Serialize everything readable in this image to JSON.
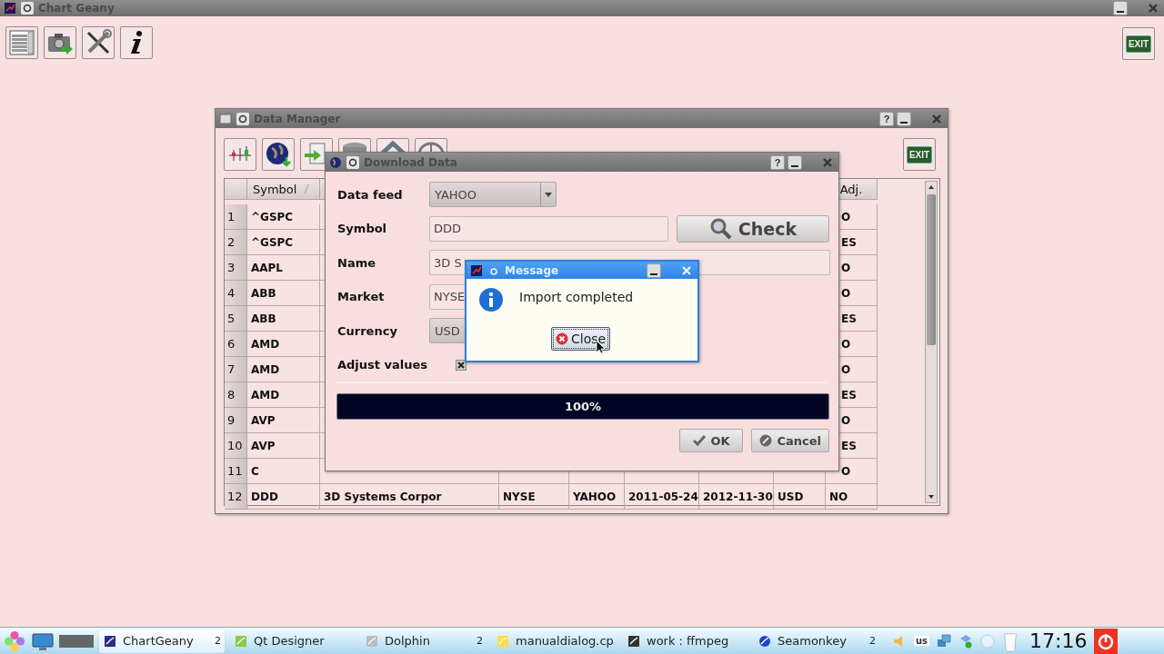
{
  "main_window": {
    "title": "Chart Geany",
    "exit_button": "EXIT"
  },
  "data_manager": {
    "title": "Data Manager",
    "help_button": "?",
    "exit_button": "EXIT",
    "table": {
      "columns": [
        "Symbol",
        "Adj."
      ],
      "rows": [
        {
          "number": "1",
          "symbol": "^GSPC",
          "adj": "O"
        },
        {
          "number": "2",
          "symbol": "^GSPC",
          "adj": "ES"
        },
        {
          "number": "3",
          "symbol": "AAPL",
          "adj": "O"
        },
        {
          "number": "4",
          "symbol": "ABB",
          "adj": "O"
        },
        {
          "number": "5",
          "symbol": "ABB",
          "adj": "ES"
        },
        {
          "number": "6",
          "symbol": "AMD",
          "adj": "O"
        },
        {
          "number": "7",
          "symbol": "AMD",
          "adj": "O"
        },
        {
          "number": "8",
          "symbol": "AMD",
          "adj": "ES"
        },
        {
          "number": "9",
          "symbol": "AVP",
          "adj": "O"
        },
        {
          "number": "10",
          "symbol": "AVP",
          "adj": "ES"
        },
        {
          "number": "11",
          "symbol": "C",
          "adj": "O"
        },
        {
          "number": "12",
          "symbol": "DDD",
          "details": [
            "3D Systems Corpor",
            "NYSE",
            "YAHOO",
            "2011-05-24",
            "2012-11-30",
            "USD"
          ],
          "adj": "NO"
        }
      ]
    }
  },
  "download_dialog": {
    "title": "Download Data",
    "help_button": "?",
    "fields": [
      {
        "label": "Data feed",
        "kind": "combo",
        "value": "YAHOO"
      },
      {
        "label": "Symbol",
        "kind": "text",
        "value": "DDD"
      },
      {
        "label": "Name",
        "kind": "text",
        "value": "3D S"
      },
      {
        "label": "Market",
        "kind": "text",
        "value": "NYSE"
      },
      {
        "label": "Currency",
        "kind": "combo",
        "value": "USD"
      },
      {
        "label": "Adjust values",
        "kind": "checkbox",
        "checked": true
      }
    ],
    "check_button": "Check",
    "progress": {
      "level": 1,
      "text": "100%"
    },
    "buttons": [
      "OK",
      "Cancel"
    ]
  },
  "message": {
    "title": "Message",
    "text": "Import completed",
    "button": "Close"
  },
  "taskbar": {
    "tasks": [
      {
        "label": "ChartGeany",
        "selected": true,
        "count": "2"
      },
      {
        "label": "Qt Designer",
        "selected": false
      },
      {
        "label": "Dolphin",
        "selected": false,
        "count": "2"
      },
      {
        "label": "manualdialog.cp",
        "selected": false
      },
      {
        "label": "work : ffmpeg",
        "selected": false
      },
      {
        "label": "Seamonkey",
        "selected": false,
        "count": "2"
      }
    ],
    "keyboard_layout": "us",
    "clock": "17:16"
  }
}
